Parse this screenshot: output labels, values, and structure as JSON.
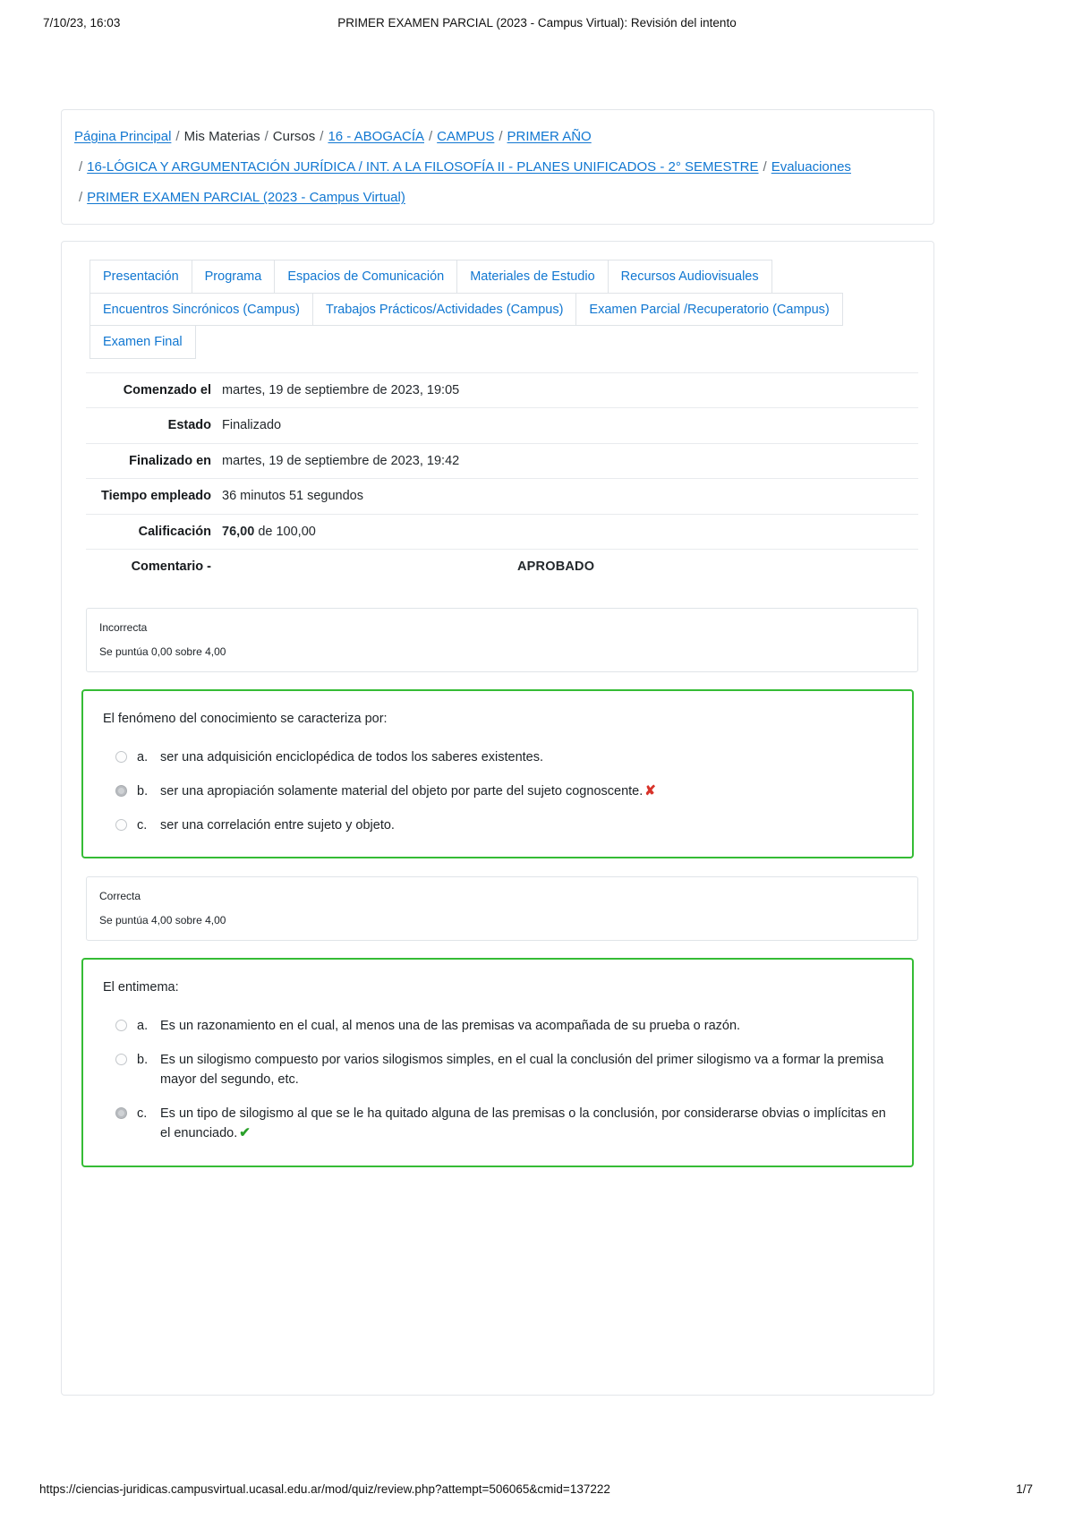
{
  "print": {
    "header_left": "7/10/23, 16:03",
    "header_center": "PRIMER EXAMEN PARCIAL (2023 - Campus Virtual): Revisión del intento",
    "footer_url": "https://ciencias-juridicas.campusvirtual.ucasal.edu.ar/mod/quiz/review.php?attempt=506065&cmid=137222",
    "footer_page": "1/7"
  },
  "breadcrumb": {
    "separator": "/",
    "lines": [
      [
        {
          "text": "Página Principal",
          "link": true
        },
        {
          "text": "Mis Materias",
          "link": false
        },
        {
          "text": "Cursos",
          "link": false
        },
        {
          "text": "16 - ABOGACÍA",
          "link": true
        },
        {
          "text": "CAMPUS",
          "link": true
        },
        {
          "text": "PRIMER AÑO",
          "link": true
        }
      ],
      [
        {
          "text": "16-LÓGICA Y ARGUMENTACIÓN JURÍDICA / INT. A LA FILOSOFÍA II - PLANES UNIFICADOS - 2° SEMESTRE",
          "link": true
        },
        {
          "text": "Evaluaciones",
          "link": true
        }
      ],
      [
        {
          "text": "PRIMER EXAMEN PARCIAL (2023 - Campus Virtual)",
          "link": true
        }
      ]
    ]
  },
  "tabs": [
    {
      "label": "Presentación"
    },
    {
      "label": "Programa"
    },
    {
      "label": "Espacios de Comunicación"
    },
    {
      "label": "Materiales de Estudio"
    },
    {
      "label": "Recursos Audiovisuales"
    },
    {
      "label": "Encuentros Sincrónicos (Campus)"
    },
    {
      "label": "Trabajos Prácticos/Actividades (Campus)"
    },
    {
      "label": "Examen Parcial /Recuperatorio (Campus)"
    },
    {
      "label": "Examen Final"
    }
  ],
  "summary": {
    "rows": [
      {
        "label": "Comenzado el",
        "value": "martes, 19 de septiembre de 2023, 19:05"
      },
      {
        "label": "Estado",
        "value": "Finalizado"
      },
      {
        "label": "Finalizado en",
        "value": "martes, 19 de septiembre de 2023, 19:42"
      },
      {
        "label": "Tiempo empleado",
        "value": "36 minutos 51 segundos"
      }
    ],
    "grade_label": "Calificación",
    "grade_value": "76,00",
    "grade_suffix": "de 100,00",
    "comment_label": "Comentario -",
    "comment_value": "APROBADO"
  },
  "questions": [
    {
      "status": "Incorrecta",
      "score_text": "Se puntúa 0,00 sobre 4,00",
      "stem": "El fenómeno del conocimiento se caracteriza por:",
      "options": [
        {
          "letter": "a.",
          "text": "ser una adquisición enciclopédica de todos los saberes existentes.",
          "selected": false,
          "mark": ""
        },
        {
          "letter": "b.",
          "text": "ser una apropiación solamente material del objeto por parte del sujeto cognoscente.",
          "selected": true,
          "mark": "✘"
        },
        {
          "letter": "c.",
          "text": "ser una correlación entre sujeto y objeto.",
          "selected": false,
          "mark": ""
        }
      ]
    },
    {
      "status": "Correcta",
      "score_text": "Se puntúa 4,00 sobre 4,00",
      "stem": "El entimema:",
      "options": [
        {
          "letter": "a.",
          "text": "Es un razonamiento en el cual, al menos una de las premisas va acompañada de su prueba o razón.",
          "selected": false,
          "mark": ""
        },
        {
          "letter": "b.",
          "text": "Es un silogismo compuesto por varios silogismos simples, en el cual la conclusión del primer silogismo va a formar la premisa mayor del segundo, etc.",
          "selected": false,
          "mark": ""
        },
        {
          "letter": "c.",
          "text": "Es un tipo de silogismo al que se le ha quitado alguna de las premisas o la conclusión, por considerarse obvias o implícitas en el enunciado.",
          "selected": true,
          "mark": "✔"
        }
      ]
    }
  ],
  "colors": {
    "link": "#1177d1",
    "question_border": "#35bc35",
    "wrong": "#d8332a",
    "right": "#2aa02a"
  }
}
